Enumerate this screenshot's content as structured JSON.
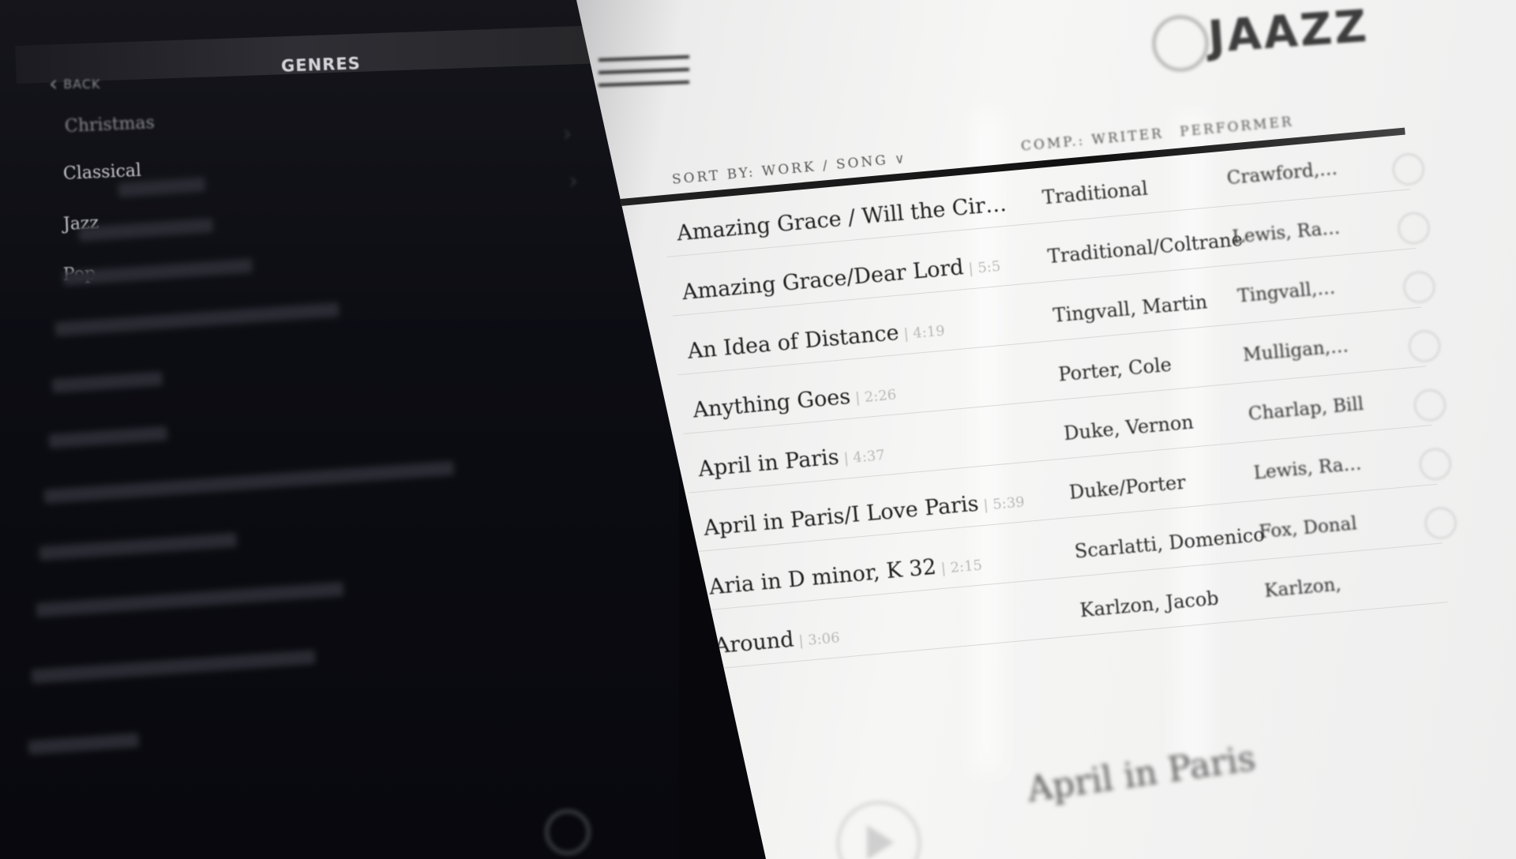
{
  "left_panel": {
    "title": "GENRES",
    "back_label": "BACK",
    "genres": [
      "Christmas",
      "Classical",
      "Jazz",
      "Pop"
    ]
  },
  "header": {
    "brand": "JAAZZ"
  },
  "sort": {
    "label": "SORT BY: WORK / SONG",
    "caret": "∨"
  },
  "columns": {
    "writer": "COMP.: WRITER",
    "performer": "PERFORMER"
  },
  "rows": [
    {
      "song": "Amazing Grace / Will the Cir…",
      "duration": "",
      "writer": "Traditional",
      "performer": "Crawford,…"
    },
    {
      "song": "Amazing Grace/Dear Lord",
      "duration": "| 5:5",
      "writer": "Traditional/Coltrane",
      "performer": "Lewis, Ra…"
    },
    {
      "song": "An Idea of Distance",
      "duration": "| 4:19",
      "writer": "Tingvall, Martin",
      "performer": "Tingvall,…"
    },
    {
      "song": "Anything Goes",
      "duration": "| 2:26",
      "writer": "Porter, Cole",
      "performer": "Mulligan,…"
    },
    {
      "song": "April in Paris",
      "duration": "| 4:37",
      "writer": "Duke, Vernon",
      "performer": "Charlap, Bill"
    },
    {
      "song": "April in Paris/I Love Paris",
      "duration": "| 5:39",
      "writer": "Duke/Porter",
      "performer": "Lewis, Ra…"
    },
    {
      "song": "Aria in D minor, K 32",
      "duration": "| 2:15",
      "writer": "Scarlatti, Domenico",
      "performer": "Fox, Donal"
    },
    {
      "song": "Around",
      "duration": "| 3:06",
      "writer": "Karlzon, Jacob",
      "performer": "Karlzon,"
    }
  ],
  "now_playing": {
    "title": "April in Paris"
  },
  "colors": {
    "left_bg": "#0c0c13",
    "right_bg": "#f4f4f3",
    "header_line": "#1a1a1a"
  }
}
